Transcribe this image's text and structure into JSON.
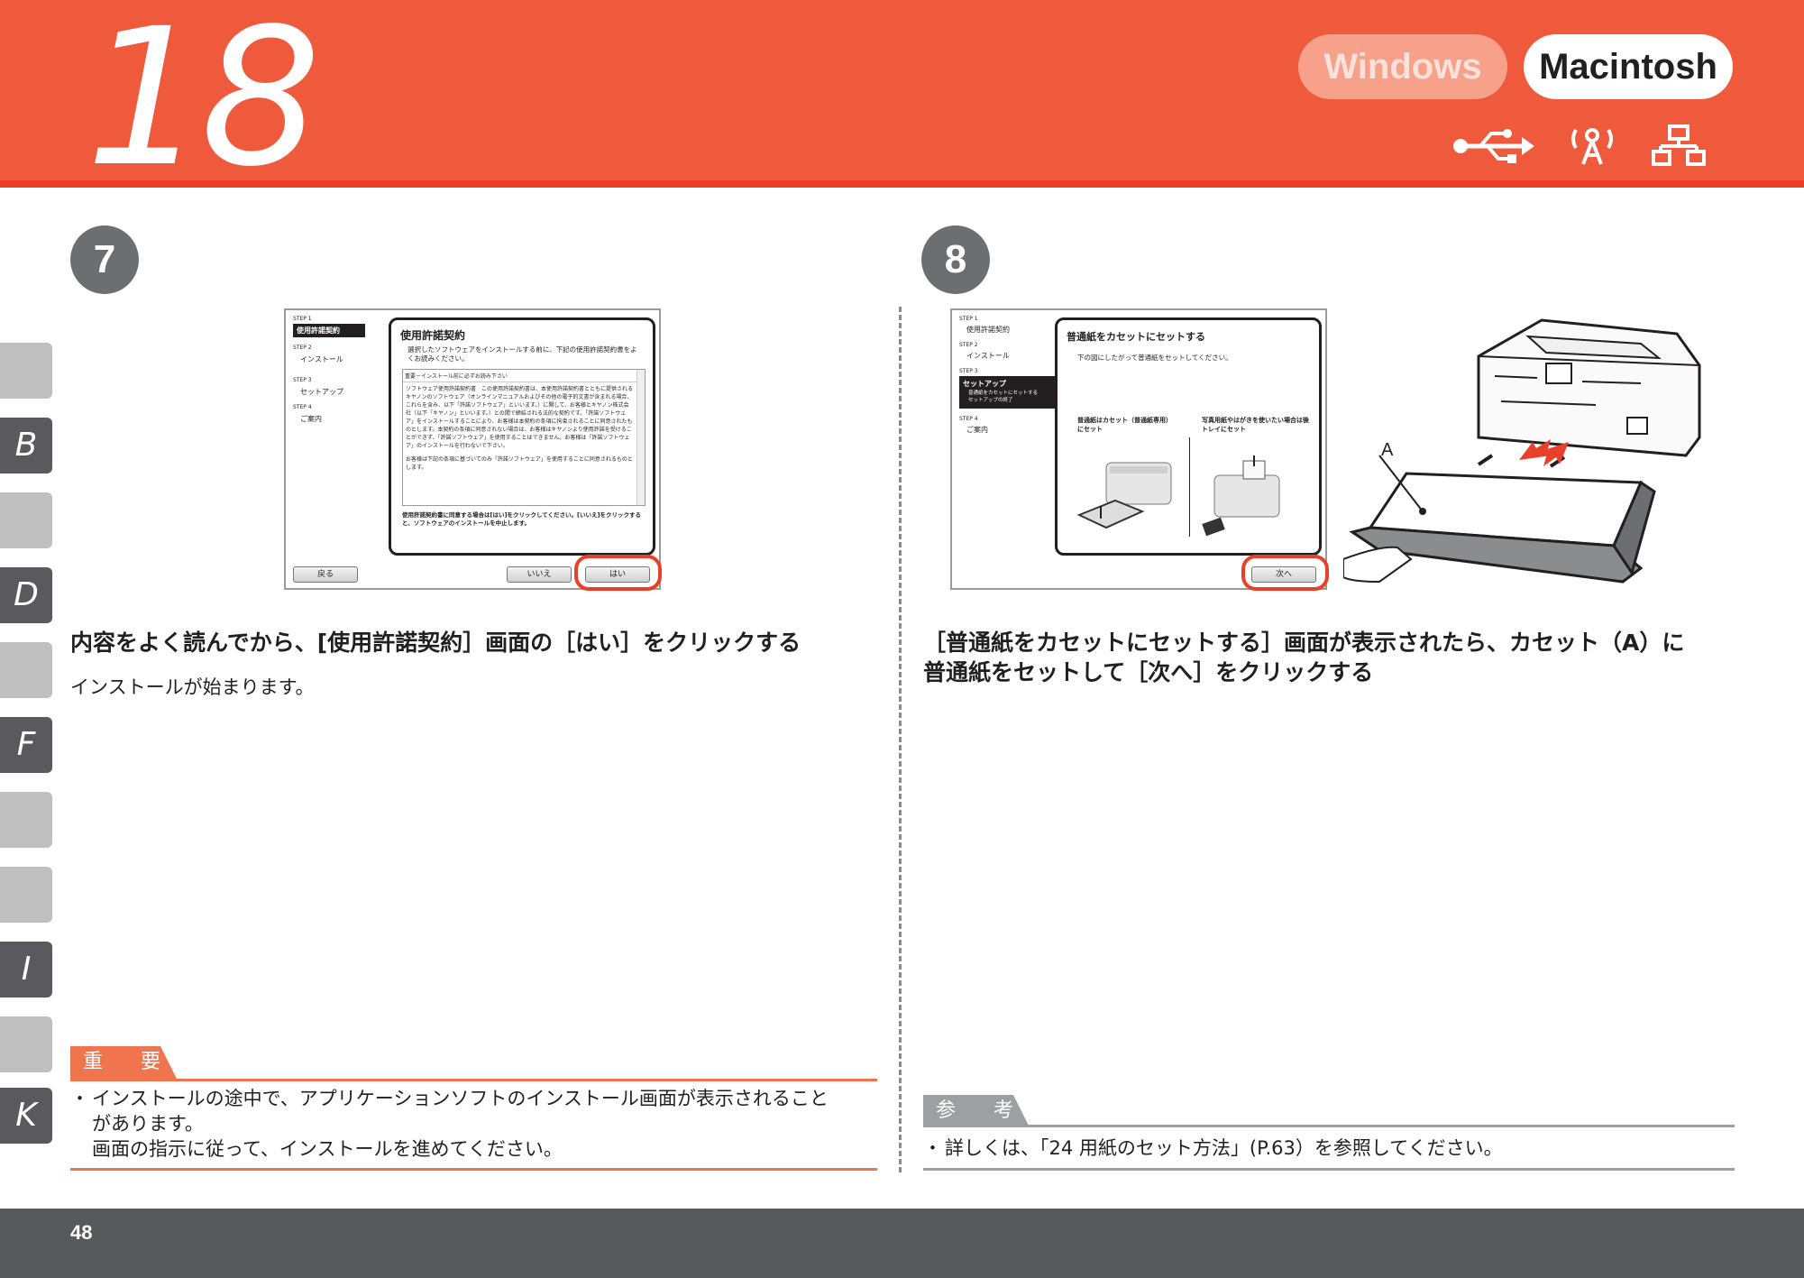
{
  "header": {
    "chapter": "18",
    "os_tabs": [
      {
        "label": "Windows",
        "state": "inactive"
      },
      {
        "label": "Macintosh",
        "state": "active"
      }
    ],
    "connection_icons": [
      "usb-icon",
      "wireless-icon",
      "network-icon"
    ],
    "colors": {
      "header_bg": "#f05a3c",
      "active_tab_bg": "#ffffff",
      "inactive_tab_bg": "#f7a08a"
    }
  },
  "side_tabs": [
    {
      "label": ""
    },
    {
      "label": "B"
    },
    {
      "label": ""
    },
    {
      "label": "D"
    },
    {
      "label": ""
    },
    {
      "label": "F"
    },
    {
      "label": ""
    },
    {
      "label": ""
    },
    {
      "label": "I"
    },
    {
      "label": ""
    },
    {
      "label": "K"
    }
  ],
  "step7": {
    "number": "7",
    "screen": {
      "sidebar": [
        {
          "step": "STEP 1",
          "label": "使用許諾契約",
          "active": true
        },
        {
          "step": "STEP 2",
          "label": "インストール",
          "active": false
        },
        {
          "step": "STEP 3",
          "label": "セットアップ",
          "active": false
        },
        {
          "step": "STEP 4",
          "label": "ご案内",
          "active": false
        }
      ],
      "title": "使用許諾契約",
      "intro": "選択したソフトウェアをインストールする前に、下記の使用許諾契約書をよくお読みください。",
      "license_heading": "重要－インストール前に必ずお読み下さい",
      "license_body": "ソフトウェア使用許諾契約書　この使用許諾契約書は、本使用許諾契約書とともに提供されるキヤノンのソフトウェア（オンラインマニュアルおよびその他の電子的文書が含まれる場合、これらを含み、以下「許諾ソフトウェア」といいます。）に関して、お客様とキヤノン株式会社（以下「キヤノン」といいます。）との間で締結される法的な契約です。「許諾ソフトウェア」をインストールすることにより、お客様は本契約の条項に拘束されることに同意されたものとします。本契約の条項に同意されない場合は、お客様はキヤノンより使用許諾を受けることができず、「許諾ソフトウェア」を使用することはできません。お客様は「許諾ソフトウェア」のインストールを行わないで下さい。",
      "license_tail": "お客様は下記の条項に基づいてのみ「許諾ソフトウェア」を使用することに同意されるものとします。",
      "agree_note": "使用許諾契約書に同意する場合は[はい]をクリックしてください。[いいえ]をクリックすると、ソフトウェアのインストールを中止します。",
      "back_button": "戻る",
      "no_button": "いいえ",
      "yes_button": "はい"
    },
    "heading": "内容をよく読んでから、[使用許諾契約］画面の［はい］をクリックする",
    "body": "インストールが始まります。",
    "note": {
      "tag": "重　要",
      "bullet": "・",
      "lines": [
        "インストールの途中で、アプリケーションソフトのインストール画面が表示されること",
        "があります。",
        "画面の指示に従って、インストールを進めてください。"
      ],
      "color": "#f0754e"
    }
  },
  "step8": {
    "number": "8",
    "screen": {
      "sidebar": [
        {
          "step": "STEP 1",
          "label": "使用許諾契約",
          "active": false
        },
        {
          "step": "STEP 2",
          "label": "インストール",
          "active": false
        },
        {
          "step": "STEP 3",
          "label": "セットアップ",
          "active": true,
          "sub": [
            "普通紙をカセットにセットする",
            "セットアップの終了"
          ]
        },
        {
          "step": "STEP 4",
          "label": "ご案内",
          "active": false
        }
      ],
      "title": "普通紙をカセットにセットする",
      "intro": "下の図にしたがって普通紙をセットしてください。",
      "left_caption": "普通紙はカセット（普通紙専用）にセット",
      "right_caption": "写真用紙やはがきを使いたい場合は後トレイにセット",
      "next_button": "次へ"
    },
    "illustration_label": "A",
    "heading_lines": [
      "［普通紙をカセットにセットする］画面が表示されたら、カセット（A）に",
      "普通紙をセットして［次へ］をクリックする"
    ],
    "note": {
      "tag": "参　考",
      "bullet": "・",
      "lines": [
        "詳しくは、「24 用紙のセット方法」(P.63）を参照してください。"
      ],
      "color": "#9d9fa2"
    }
  },
  "footer": {
    "page_number": "48"
  }
}
